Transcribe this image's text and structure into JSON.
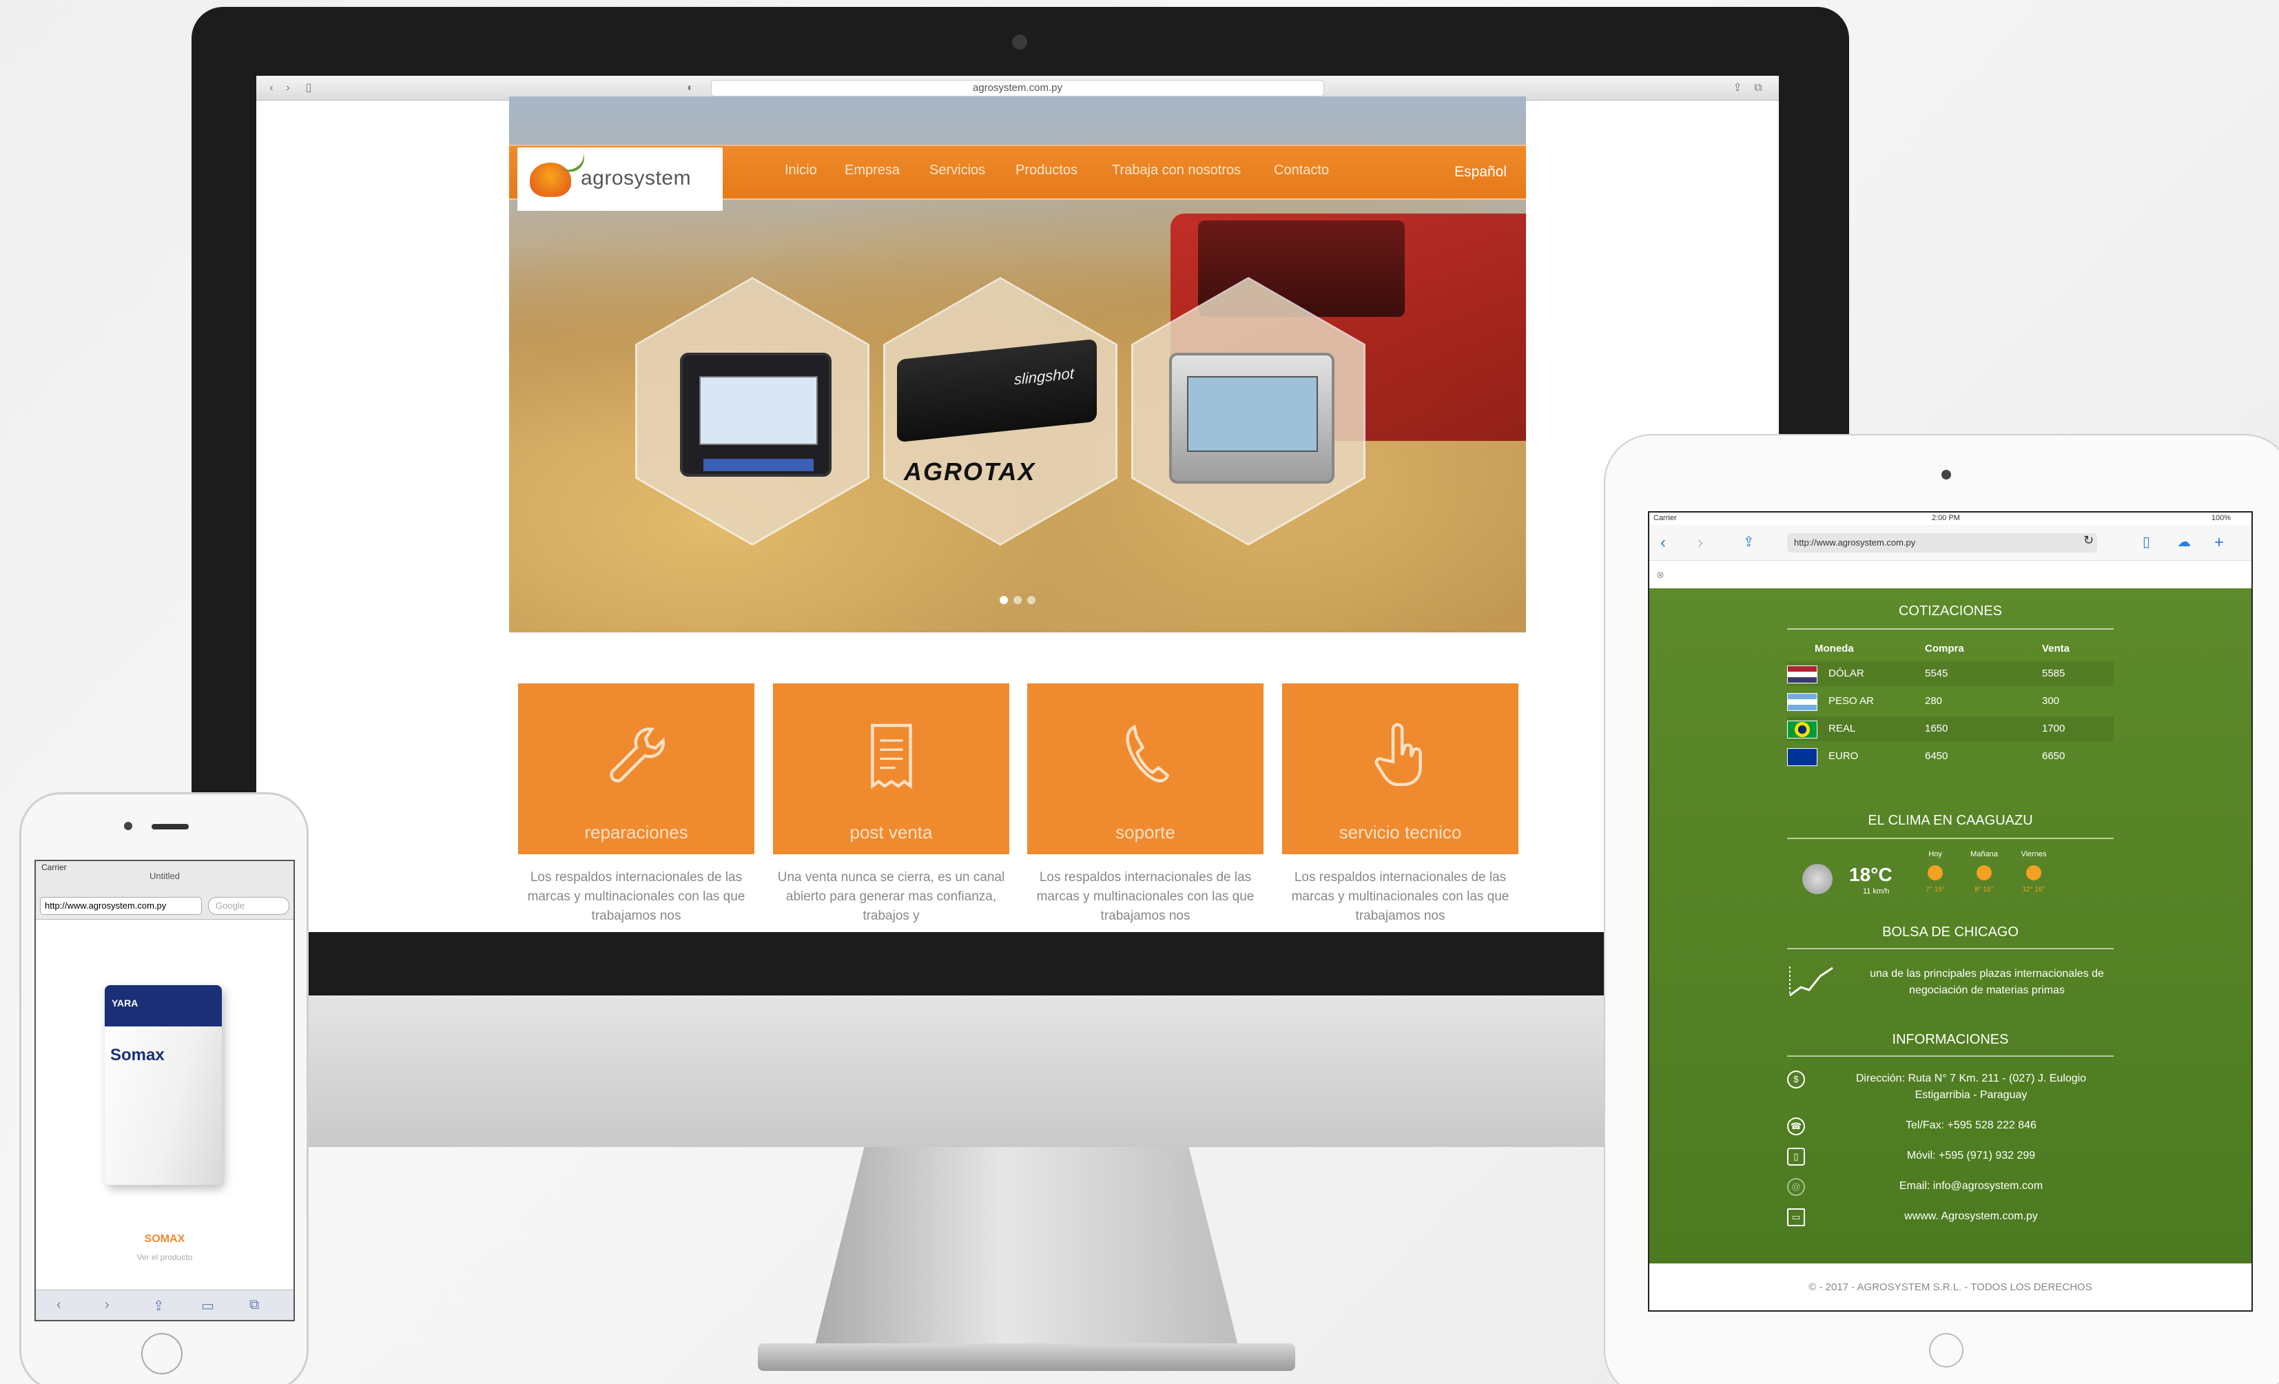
{
  "imac": {
    "url": "agrosystem.com.py",
    "site": {
      "logo_text": "agrosystem",
      "nav": [
        "Inicio",
        "Empresa",
        "Servicios",
        "Productos",
        "Trabaja con nosotros",
        "Contacto"
      ],
      "language": "Español",
      "hero_brand": "AGROTAX",
      "hero_device_label": "slingshot",
      "slider_dots": 3,
      "tiles": [
        {
          "label": "reparaciones",
          "icon": "wrench-icon",
          "text": "Los respaldos internacionales de las marcas y multinacionales con las que trabajamos nos"
        },
        {
          "label": "post venta",
          "icon": "receipt-icon",
          "text": "Una venta nunca se cierra, es un canal abierto para generar mas confianza, trabajos y"
        },
        {
          "label": "soporte",
          "icon": "phone-icon",
          "text": "Los respaldos internacionales de las marcas y multinacionales con las que trabajamos nos"
        },
        {
          "label": "servicio tecnico",
          "icon": "hand-pointer-icon",
          "text": "Los respaldos internacionales de las marcas y multinacionales con las que trabajamos nos"
        }
      ],
      "accent_color": "#f08a2f"
    }
  },
  "ipad": {
    "status_carrier": "Carrier",
    "status_time": "2:00 PM",
    "status_battery": "100%",
    "url": "http://www.agrosystem.com.py",
    "cotizaciones": {
      "title": "COTIZACIONES",
      "headers": [
        "Moneda",
        "Compra",
        "Venta"
      ],
      "rows": [
        {
          "currency": "DÓLAR",
          "compra": "5545",
          "venta": "5585"
        },
        {
          "currency": "PESO AR",
          "compra": "280",
          "venta": "300"
        },
        {
          "currency": "REAL",
          "compra": "1650",
          "venta": "1700"
        },
        {
          "currency": "EURO",
          "compra": "6450",
          "venta": "6650"
        }
      ]
    },
    "clima": {
      "title": "EL CLIMA EN CAAGUAZU",
      "temp": "18°C",
      "wind": "11 km/h",
      "days": [
        {
          "day": "Hoy",
          "range": "7° 15°"
        },
        {
          "day": "Mañana",
          "range": "8° 15°"
        },
        {
          "day": "Viernes",
          "range": "12° 16°"
        }
      ]
    },
    "bolsa": {
      "title": "BOLSA DE CHICAGO",
      "text": "una de las principales plazas internacionales de negociación de materias primas"
    },
    "informaciones": {
      "title": "INFORMACIONES",
      "items": [
        {
          "icon": "location-icon",
          "text": "Dirección: Ruta N° 7 Km. 211 - (027) J. Eulogio Estigarribia - Paraguay"
        },
        {
          "icon": "phone-icon",
          "text": "Tel/Fax: +595 528 222 846"
        },
        {
          "icon": "mobile-icon",
          "text": "Móvil: +595 (971) 932 299"
        },
        {
          "icon": "email-icon",
          "text": "Email: info@agrosystem.com"
        },
        {
          "icon": "web-icon",
          "text": "wwww. Agrosystem.com.py"
        }
      ]
    },
    "footer": "© - 2017 - AGROSYSTEM S.R.L. - TODOS LOS DERECHOS",
    "green_color": "#5d8a2a"
  },
  "iphone": {
    "carrier": "Carrier",
    "title": "Untitled",
    "url": "http://www.agrosystem.com.py",
    "search_placeholder": "Google",
    "product_brand": "Somax",
    "product_maker": "YARA",
    "product_name": "SOMAX",
    "product_link": "Ver el producto"
  }
}
